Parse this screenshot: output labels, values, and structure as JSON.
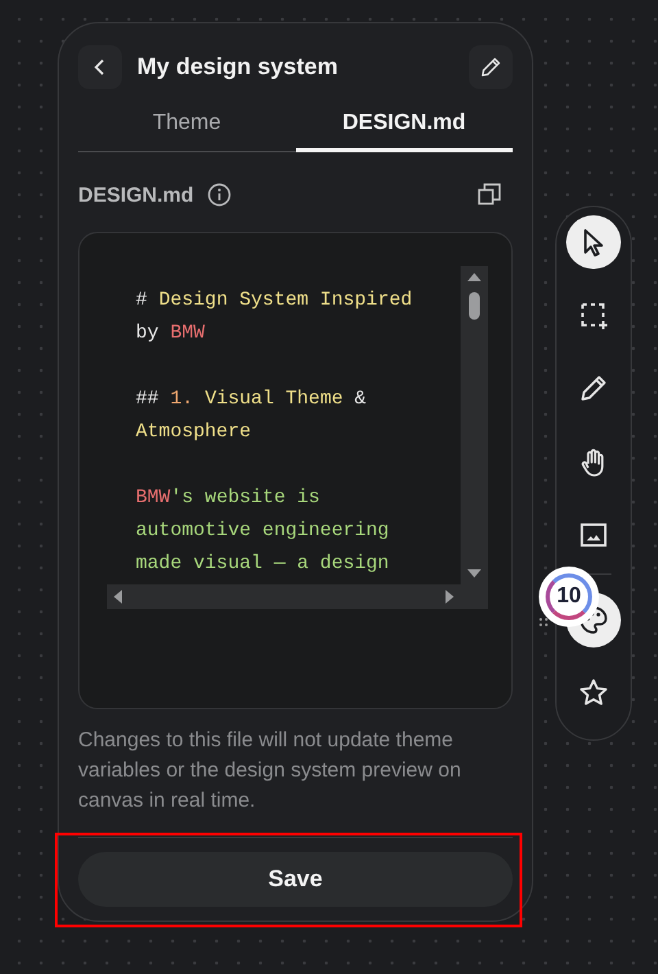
{
  "panel": {
    "title": "My design system",
    "tabs": [
      {
        "label": "Theme",
        "selected": false
      },
      {
        "label": "DESIGN.md",
        "selected": true
      }
    ],
    "file_header": {
      "label": "DESIGN.md"
    },
    "editor": {
      "blocks": [
        [
          {
            "kind": "marker",
            "text": "# "
          },
          {
            "kind": "heading",
            "text": "Design System Inspired "
          },
          {
            "kind": "plain",
            "text": "by "
          },
          {
            "kind": "brand",
            "text": "BMW"
          }
        ],
        [
          {
            "kind": "marker",
            "text": "## "
          },
          {
            "kind": "number",
            "text": "1. "
          },
          {
            "kind": "heading",
            "text": "Visual Theme "
          },
          {
            "kind": "plain",
            "text": "& "
          },
          {
            "kind": "heading",
            "text": "Atmosphere"
          }
        ],
        [
          {
            "kind": "brand",
            "text": "BMW"
          },
          {
            "kind": "body",
            "text": "'s website is automotive engineering made visual — a design"
          }
        ]
      ]
    },
    "note": "Changes to this file will not update theme variables or the design system preview on canvas in real time.",
    "save_button": {
      "label": "Save",
      "highlighted": true
    }
  },
  "toolbar": {
    "tools": [
      {
        "kind": "pointer",
        "selected": true
      },
      {
        "kind": "region",
        "selected": false
      },
      {
        "kind": "pencil",
        "selected": false
      },
      {
        "kind": "hand",
        "selected": false
      },
      {
        "kind": "image",
        "selected": false
      },
      {
        "kind": "palette",
        "selected": true
      },
      {
        "kind": "star",
        "selected": false
      }
    ],
    "badge": "10"
  }
}
